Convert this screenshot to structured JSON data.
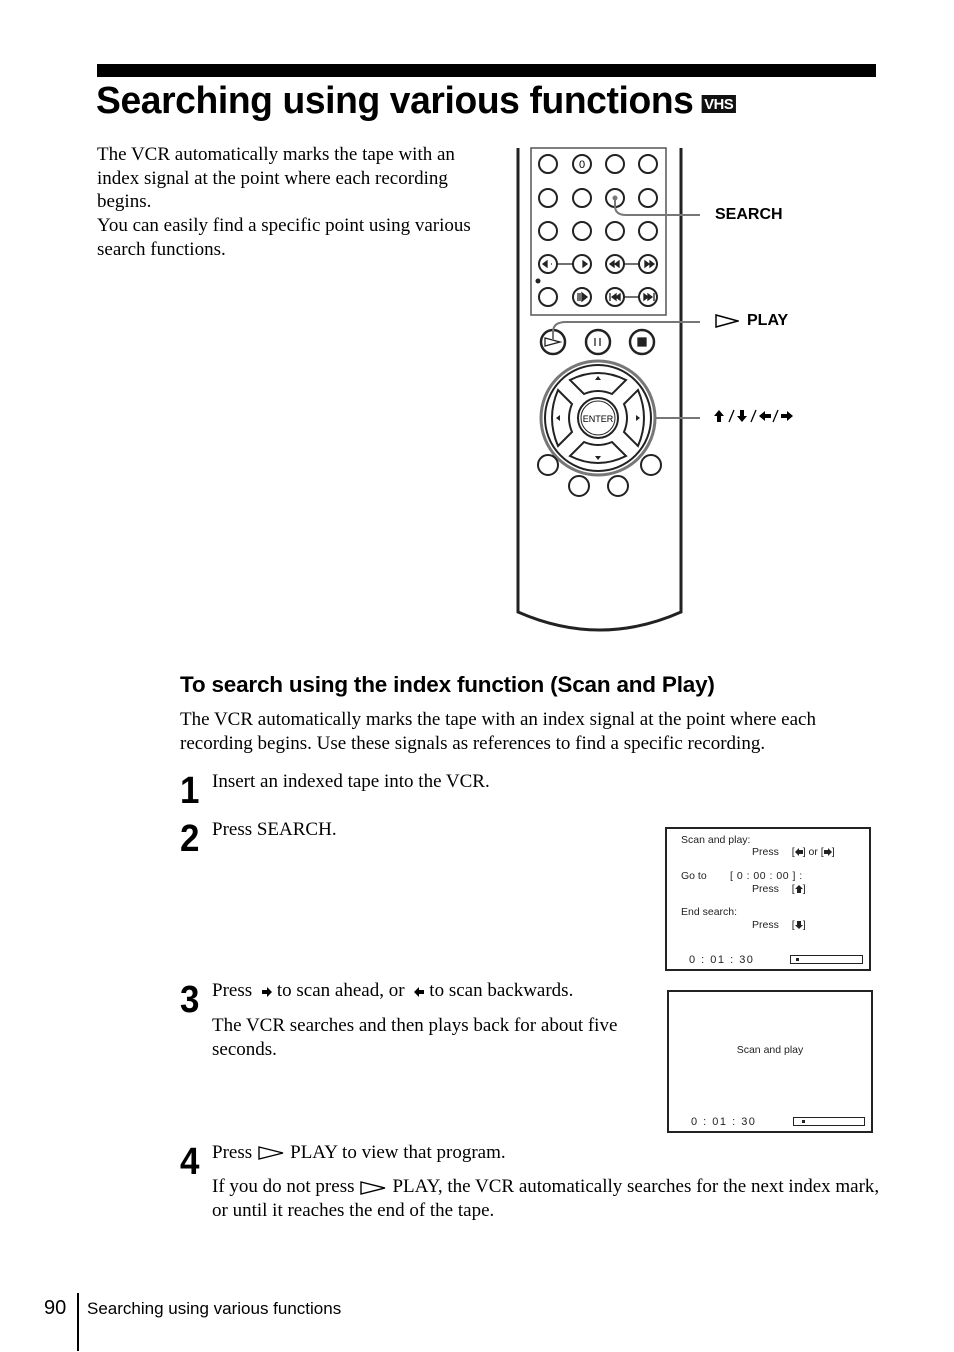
{
  "page": {
    "title": "Searching using various functions",
    "badge": "VHS",
    "intro_paragraphs": [
      "The VCR automatically marks the tape with an index signal at the point where each recording begins.",
      "You can easily find a specific point using various search functions."
    ]
  },
  "remote_figure": {
    "callouts": {
      "search": "SEARCH",
      "play": "PLAY",
      "arrows": "↑/↓/←/→"
    },
    "button_labels": {
      "zero": "0",
      "enter": "ENTER"
    }
  },
  "section": {
    "heading": "To search using the index function (Scan and Play)",
    "body": "The VCR automatically marks the tape with an index signal at the point where each recording begins.  Use these signals as references to find a specific recording.",
    "steps": [
      {
        "number": "1",
        "text": "Insert an indexed tape into the VCR."
      },
      {
        "number": "2",
        "text": "Press SEARCH."
      },
      {
        "number": "3",
        "text_before": "Press",
        "text_middle": "to scan ahead, or",
        "text_after": "to scan backwards.",
        "sub": "The VCR searches and then plays back for about five seconds."
      },
      {
        "number": "4",
        "text_before": "Press",
        "text_after": "PLAY to view that program.",
        "sub_before": "If you do not press",
        "sub_after": "PLAY, the VCR automatically searches for the next index mark, or until it reaches the end of the tape."
      }
    ]
  },
  "screens": {
    "menu": {
      "scan_label": "Scan and play:",
      "press": "Press",
      "or": "or",
      "goto_label": "Go to",
      "goto_value": "[ 0 : 00 : 00 ] :",
      "end_label": "End search:",
      "counter": "0 : 01 : 30",
      "tape_position": 0.08
    },
    "scanning": {
      "message": "Scan and play",
      "counter": "0 : 01 : 30",
      "tape_position": 0.12
    }
  },
  "footer": {
    "page_number": "90",
    "running_title": "Searching using various functions"
  }
}
